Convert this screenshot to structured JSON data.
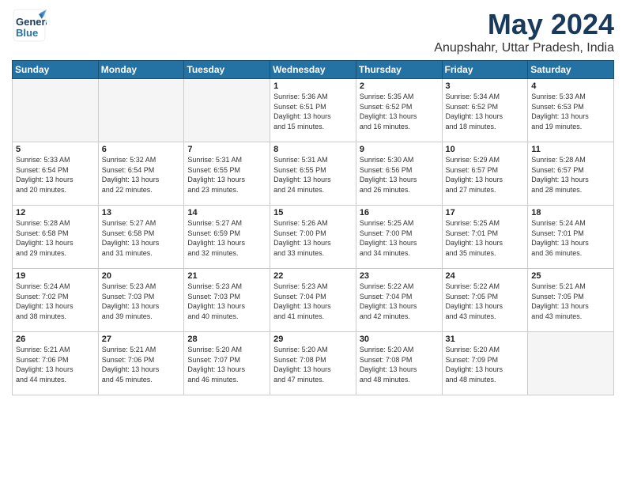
{
  "logo": {
    "line1": "General",
    "line2": "Blue"
  },
  "title": {
    "month": "May 2024",
    "location": "Anupshahr, Uttar Pradesh, India"
  },
  "days_of_week": [
    "Sunday",
    "Monday",
    "Tuesday",
    "Wednesday",
    "Thursday",
    "Friday",
    "Saturday"
  ],
  "weeks": [
    [
      {
        "day": "",
        "info": "",
        "empty": true
      },
      {
        "day": "",
        "info": "",
        "empty": true
      },
      {
        "day": "",
        "info": "",
        "empty": true
      },
      {
        "day": "1",
        "info": "Sunrise: 5:36 AM\nSunset: 6:51 PM\nDaylight: 13 hours\nand 15 minutes.",
        "empty": false
      },
      {
        "day": "2",
        "info": "Sunrise: 5:35 AM\nSunset: 6:52 PM\nDaylight: 13 hours\nand 16 minutes.",
        "empty": false
      },
      {
        "day": "3",
        "info": "Sunrise: 5:34 AM\nSunset: 6:52 PM\nDaylight: 13 hours\nand 18 minutes.",
        "empty": false
      },
      {
        "day": "4",
        "info": "Sunrise: 5:33 AM\nSunset: 6:53 PM\nDaylight: 13 hours\nand 19 minutes.",
        "empty": false
      }
    ],
    [
      {
        "day": "5",
        "info": "Sunrise: 5:33 AM\nSunset: 6:54 PM\nDaylight: 13 hours\nand 20 minutes.",
        "empty": false
      },
      {
        "day": "6",
        "info": "Sunrise: 5:32 AM\nSunset: 6:54 PM\nDaylight: 13 hours\nand 22 minutes.",
        "empty": false
      },
      {
        "day": "7",
        "info": "Sunrise: 5:31 AM\nSunset: 6:55 PM\nDaylight: 13 hours\nand 23 minutes.",
        "empty": false
      },
      {
        "day": "8",
        "info": "Sunrise: 5:31 AM\nSunset: 6:55 PM\nDaylight: 13 hours\nand 24 minutes.",
        "empty": false
      },
      {
        "day": "9",
        "info": "Sunrise: 5:30 AM\nSunset: 6:56 PM\nDaylight: 13 hours\nand 26 minutes.",
        "empty": false
      },
      {
        "day": "10",
        "info": "Sunrise: 5:29 AM\nSunset: 6:57 PM\nDaylight: 13 hours\nand 27 minutes.",
        "empty": false
      },
      {
        "day": "11",
        "info": "Sunrise: 5:28 AM\nSunset: 6:57 PM\nDaylight: 13 hours\nand 28 minutes.",
        "empty": false
      }
    ],
    [
      {
        "day": "12",
        "info": "Sunrise: 5:28 AM\nSunset: 6:58 PM\nDaylight: 13 hours\nand 29 minutes.",
        "empty": false
      },
      {
        "day": "13",
        "info": "Sunrise: 5:27 AM\nSunset: 6:58 PM\nDaylight: 13 hours\nand 31 minutes.",
        "empty": false
      },
      {
        "day": "14",
        "info": "Sunrise: 5:27 AM\nSunset: 6:59 PM\nDaylight: 13 hours\nand 32 minutes.",
        "empty": false
      },
      {
        "day": "15",
        "info": "Sunrise: 5:26 AM\nSunset: 7:00 PM\nDaylight: 13 hours\nand 33 minutes.",
        "empty": false
      },
      {
        "day": "16",
        "info": "Sunrise: 5:25 AM\nSunset: 7:00 PM\nDaylight: 13 hours\nand 34 minutes.",
        "empty": false
      },
      {
        "day": "17",
        "info": "Sunrise: 5:25 AM\nSunset: 7:01 PM\nDaylight: 13 hours\nand 35 minutes.",
        "empty": false
      },
      {
        "day": "18",
        "info": "Sunrise: 5:24 AM\nSunset: 7:01 PM\nDaylight: 13 hours\nand 36 minutes.",
        "empty": false
      }
    ],
    [
      {
        "day": "19",
        "info": "Sunrise: 5:24 AM\nSunset: 7:02 PM\nDaylight: 13 hours\nand 38 minutes.",
        "empty": false
      },
      {
        "day": "20",
        "info": "Sunrise: 5:23 AM\nSunset: 7:03 PM\nDaylight: 13 hours\nand 39 minutes.",
        "empty": false
      },
      {
        "day": "21",
        "info": "Sunrise: 5:23 AM\nSunset: 7:03 PM\nDaylight: 13 hours\nand 40 minutes.",
        "empty": false
      },
      {
        "day": "22",
        "info": "Sunrise: 5:23 AM\nSunset: 7:04 PM\nDaylight: 13 hours\nand 41 minutes.",
        "empty": false
      },
      {
        "day": "23",
        "info": "Sunrise: 5:22 AM\nSunset: 7:04 PM\nDaylight: 13 hours\nand 42 minutes.",
        "empty": false
      },
      {
        "day": "24",
        "info": "Sunrise: 5:22 AM\nSunset: 7:05 PM\nDaylight: 13 hours\nand 43 minutes.",
        "empty": false
      },
      {
        "day": "25",
        "info": "Sunrise: 5:21 AM\nSunset: 7:05 PM\nDaylight: 13 hours\nand 43 minutes.",
        "empty": false
      }
    ],
    [
      {
        "day": "26",
        "info": "Sunrise: 5:21 AM\nSunset: 7:06 PM\nDaylight: 13 hours\nand 44 minutes.",
        "empty": false
      },
      {
        "day": "27",
        "info": "Sunrise: 5:21 AM\nSunset: 7:06 PM\nDaylight: 13 hours\nand 45 minutes.",
        "empty": false
      },
      {
        "day": "28",
        "info": "Sunrise: 5:20 AM\nSunset: 7:07 PM\nDaylight: 13 hours\nand 46 minutes.",
        "empty": false
      },
      {
        "day": "29",
        "info": "Sunrise: 5:20 AM\nSunset: 7:08 PM\nDaylight: 13 hours\nand 47 minutes.",
        "empty": false
      },
      {
        "day": "30",
        "info": "Sunrise: 5:20 AM\nSunset: 7:08 PM\nDaylight: 13 hours\nand 48 minutes.",
        "empty": false
      },
      {
        "day": "31",
        "info": "Sunrise: 5:20 AM\nSunset: 7:09 PM\nDaylight: 13 hours\nand 48 minutes.",
        "empty": false
      },
      {
        "day": "",
        "info": "",
        "empty": true
      }
    ]
  ]
}
